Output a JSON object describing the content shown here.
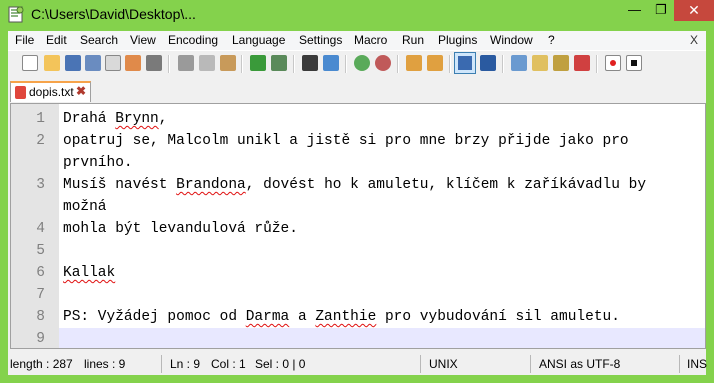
{
  "window": {
    "title": "C:\\Users\\David\\Desktop\\...",
    "controls": {
      "minimize": "—",
      "maximize": "❐",
      "close": "✕"
    }
  },
  "menu": {
    "items": [
      "File",
      "Edit",
      "Search",
      "View",
      "Encoding",
      "Language",
      "Settings",
      "Macro",
      "Run",
      "Plugins",
      "Window",
      "?"
    ],
    "close_doc": "X"
  },
  "toolbar": {
    "icons": [
      "new-file-icon",
      "open-file-icon",
      "save-icon",
      "save-all-icon",
      "close-icon",
      "close-all-icon",
      "print-icon",
      "cut-icon",
      "copy-icon",
      "paste-icon",
      "undo-icon",
      "redo-icon",
      "find-icon",
      "replace-icon",
      "zoom-in-icon",
      "zoom-out-icon",
      "sync-vertical-icon",
      "sync-horizontal-icon",
      "word-wrap-icon",
      "show-all-chars-icon",
      "indent-guide-icon",
      "doc-map-icon",
      "function-list-icon",
      "folder-workspace-icon",
      "record-macro-icon",
      "stop-record-icon"
    ]
  },
  "tab": {
    "label": "dopis.txt",
    "close": "✖"
  },
  "editor": {
    "lines": [
      {
        "num": "1",
        "parts": [
          {
            "t": "Drahá "
          },
          {
            "t": "Brynn",
            "s": true
          },
          {
            "t": ","
          }
        ]
      },
      {
        "num": "2",
        "parts": [
          {
            "t": "opatruj se, Malcolm unikl a jistě si pro mne brzy přijde jako pro"
          }
        ]
      },
      {
        "num": "",
        "parts": [
          {
            "t": "prvního."
          }
        ]
      },
      {
        "num": "3",
        "parts": [
          {
            "t": "Musíš navést "
          },
          {
            "t": "Brandona",
            "s": true
          },
          {
            "t": ", dovést ho k amuletu, klíčem k zaříkávadlu by"
          }
        ]
      },
      {
        "num": "",
        "parts": [
          {
            "t": "možná"
          }
        ]
      },
      {
        "num": "4",
        "parts": [
          {
            "t": "mohla být levandulová růže."
          }
        ]
      },
      {
        "num": "5",
        "parts": [
          {
            "t": ""
          }
        ]
      },
      {
        "num": "6",
        "parts": [
          {
            "t": "Kallak",
            "s": true
          }
        ]
      },
      {
        "num": "7",
        "parts": [
          {
            "t": ""
          }
        ]
      },
      {
        "num": "8",
        "parts": [
          {
            "t": "PS: Vyžádej pomoc od "
          },
          {
            "t": "Darma",
            "s": true
          },
          {
            "t": " a "
          },
          {
            "t": "Zanthie",
            "s": true
          },
          {
            "t": " pro vybudování sil amuletu."
          }
        ]
      },
      {
        "num": "9",
        "parts": [
          {
            "t": ""
          }
        ],
        "current": true
      }
    ]
  },
  "status": {
    "length": "length : 287",
    "lines": "lines : 9",
    "ln": "Ln : 9",
    "col": "Col : 1",
    "sel": "Sel : 0 | 0",
    "eol": "UNIX",
    "encoding": "ANSI as UTF-8",
    "mode": "INS"
  },
  "colors": {
    "frame": "#84d24c",
    "close": "#c6483d",
    "current_line": "#e8e8ff",
    "gutter": "#e4e4e4",
    "tab_accent": "#f6a34a"
  }
}
